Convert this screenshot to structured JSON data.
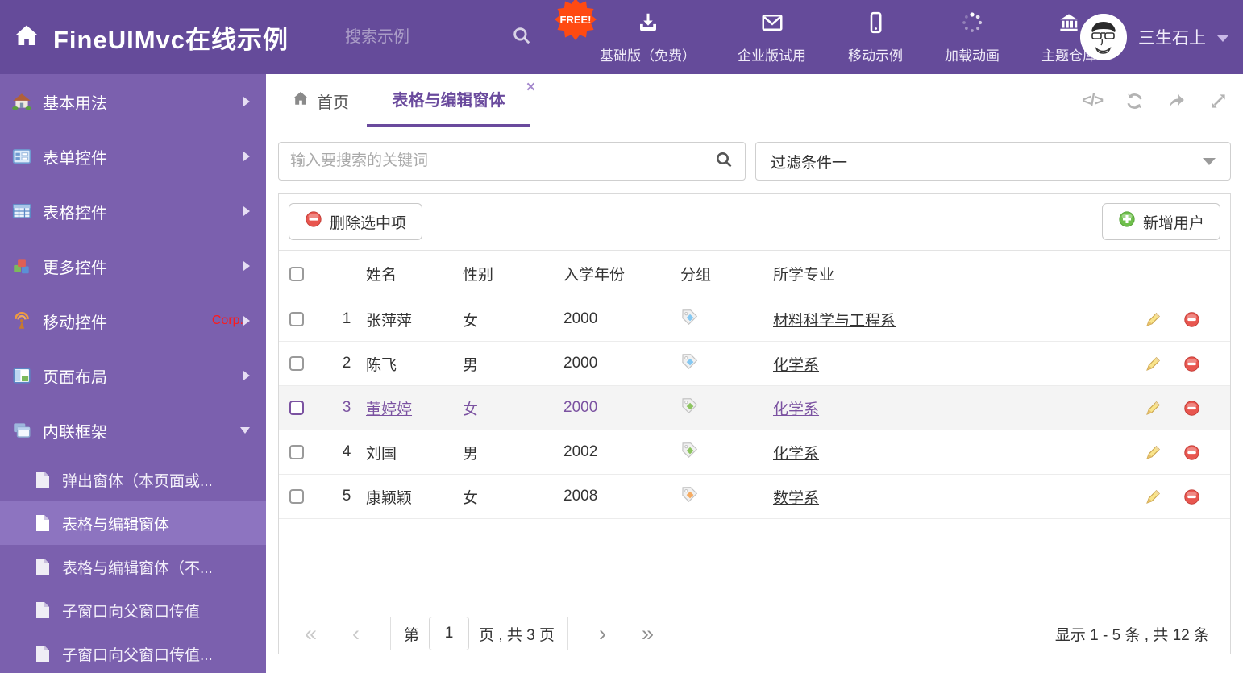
{
  "colors": {
    "header_bg": "#654b9a",
    "sidebar_bg": "#7b60ae",
    "sidebar_selected_bg": "#8d74c0",
    "accent_purple": "#6a4a9d",
    "selected_row_text": "#7b52a1",
    "free_badge_bg": "#ff4a12",
    "delete_red": "#e8564f",
    "add_green": "#6fbf4c",
    "tag_blue": "#85c8f2",
    "tag_green": "#8dc460",
    "tag_orange": "#f5ab62"
  },
  "icons": {
    "close": "×",
    "code": "</>",
    "pager_first": "«",
    "pager_prev": "‹",
    "pager_next": "›",
    "pager_last": "»"
  },
  "header": {
    "title": "FineUIMvc在线示例",
    "search_placeholder": "搜索示例",
    "free_badge": "FREE!",
    "nav": [
      {
        "label": "基础版（免费）"
      },
      {
        "label": "企业版试用"
      },
      {
        "label": "移动示例"
      },
      {
        "label": "加载动画"
      },
      {
        "label": "主题仓库"
      }
    ],
    "username": "三生石上"
  },
  "sidebar": {
    "items": [
      {
        "label": "基本用法"
      },
      {
        "label": "表单控件"
      },
      {
        "label": "表格控件"
      },
      {
        "label": "更多控件"
      },
      {
        "label": "移动控件",
        "badge": "Corp."
      },
      {
        "label": "页面布局"
      },
      {
        "label": "内联框架"
      }
    ],
    "subitems": [
      {
        "label": "弹出窗体（本页面或..."
      },
      {
        "label": "表格与编辑窗体"
      },
      {
        "label": "表格与编辑窗体（不..."
      },
      {
        "label": "子窗口向父窗口传值"
      },
      {
        "label": "子窗口向父窗口传值..."
      }
    ]
  },
  "tabs": {
    "home": "首页",
    "active": "表格与编辑窗体"
  },
  "filters": {
    "search_placeholder": "输入要搜索的关键词",
    "dropdown_value": "过滤条件一"
  },
  "toolbar": {
    "delete_label": "删除选中项",
    "add_label": "新增用户"
  },
  "table": {
    "columns": {
      "name": "姓名",
      "gender": "性别",
      "year": "入学年份",
      "group": "分组",
      "major": "所学专业"
    },
    "rows": [
      {
        "num": "1",
        "name": "张萍萍",
        "gender": "女",
        "year": "2000",
        "tag_color": "#85c8f2",
        "major": "材料科学与工程系",
        "selected": false
      },
      {
        "num": "2",
        "name": "陈飞",
        "gender": "男",
        "year": "2000",
        "tag_color": "#85c8f2",
        "major": "化学系",
        "selected": false
      },
      {
        "num": "3",
        "name": "董婷婷",
        "gender": "女",
        "year": "2000",
        "tag_color": "#8dc460",
        "major": "化学系",
        "selected": true
      },
      {
        "num": "4",
        "name": "刘国",
        "gender": "男",
        "year": "2002",
        "tag_color": "#8dc460",
        "major": "化学系",
        "selected": false
      },
      {
        "num": "5",
        "name": "康颖颖",
        "gender": "女",
        "year": "2008",
        "tag_color": "#f5ab62",
        "major": "数学系",
        "selected": false
      }
    ]
  },
  "pagination": {
    "page_label_prefix": "第",
    "page_value": "1",
    "page_label_suffix": "页 , 共 3 页",
    "summary": "显示 1 - 5 条 , 共 12 条"
  }
}
